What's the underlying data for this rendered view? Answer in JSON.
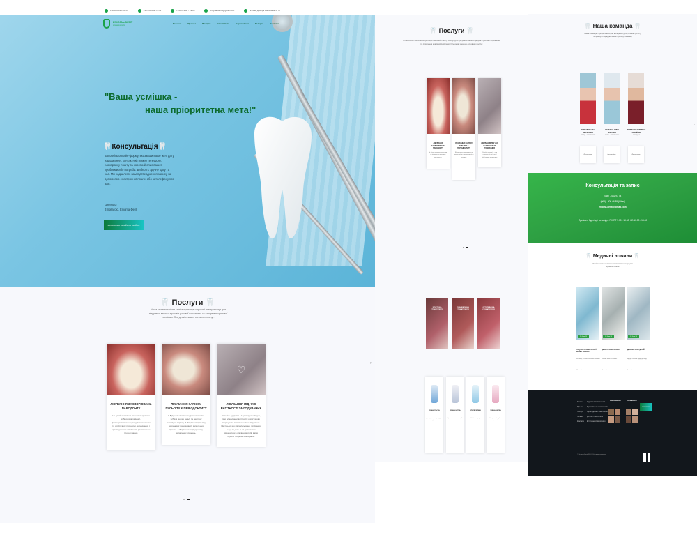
{
  "topbar": {
    "phone1": "+38 066-320-65-55",
    "phone2": "+38 068-652-74-74",
    "hours": "ПН-ПТ 9:00 - 19:00",
    "email": "enigma.dent0@gmail.com",
    "address": "м.Київ, Дмитра Шерепана 5, 72"
  },
  "logo": {
    "name": "ENIGMA-DENT",
    "tagline": "стоматологія"
  },
  "nav": [
    "Головна",
    "Про нас",
    "Послуги",
    "Спеціалісти",
    "Сертифікати",
    "Галерея",
    "Контакти"
  ],
  "hero": {
    "quote_line1": "\"Ваша усмішка -",
    "quote_line2": "наша пріоритетна мета!\"",
    "consult_title": "Консультація",
    "consult_text": "Заповніть онлайн-форму, вказавши ваше ім'я, дату народження, контактний номер телефону, електронну пошту та короткий опис вашої проблеми або потреби. Виберіть зручну дату та час. Ми надішлемо вам підтвердження запису за допомогою електронної пошти або зателефонуємо вам.",
    "thanks": "Дякуємо!",
    "regards": "З повагою, Enigma-Dent",
    "button": "ЗАПИСАТИСЬ ОНЛАЙН НА ПРИЙОМ"
  },
  "services": {
    "title": "Послуги",
    "desc": "Наша стоматологічна клініка пропонує широкий спектр послуг для підтримки вашого здоров'я ротової порожнини та створення красивої посмішки. Ось деякі з наших основних послуг:",
    "cards": [
      {
        "title": "ЛІКУВАННЯ ЗАХВОРЮВАНЬ ПАРОДОНТУ",
        "desc": "Це цілий комплекс пологових (чистка зубних відкладень), фізіотерапевтичних, медикаментозних та хірургічних процедур, шинування, і ортопедичного лікування, раціональне протезування."
      },
      {
        "title": "ЛІКУВАННЯ КАРІЄСУ ПУЛЬПІТУ & ПЕРІОДОНТИТУ",
        "desc": "● Відновлення пошкодження тканин зубів в межах емалі та дентину внаслідок карієсу. ● Лікування пульпіту (кореневої порожнини), запалення пульпи. ● Лікування періодонтиту запальних уражень."
      },
      {
        "title": "ЛІКУВАННЯ ПІД ЧАС ВАГІТНОСТІ ТА ГОДУВАННЯ",
        "desc": "Сімейне здоров'я - в цілому необхідно, при плануванні вагітності обов'язково звернутися стоматологічне лікування. Не тільки, що матимуть вони лікування, а ще та діло - і за допомогою своєчасного лікування зубів вами будете потрібно матеріали."
      }
    ]
  },
  "mid": {
    "title": "Послуги",
    "desc": "Стоматологічна клініка пропонує широкий спектр послуг для підтримки вашого здоров'я ротової порожнини та створення красивої посмішки. Ось деякі з наших основних послуг:",
    "cards": [
      {
        "title": "ЛІКУВАННЯ ЗАХВОРЮВАНЬ ПАРОДОНТУ",
        "desc": "Це цілий комплекс пологових та хірургічних процедур, шинування."
      },
      {
        "title": "ЛІКУВАННЯ КАРІЄСУ ПУЛЬПІТУ & ПЕРІОДОНТИТУ",
        "desc": "Відновлення пошкодження тканин зубів в межах емалі та дентину."
      },
      {
        "title": "ЛІКУВАННЯ ПІД ЧАС ВАГІТНОСТІ ТА ГОДУВАННЯ",
        "desc": "Сімейне здоров'я - при плануванні вагітності обов'язково звернутися."
      }
    ],
    "specs": [
      "ХІРУРГІЧНА СТОМАТОЛОГІЯ",
      "ТЕРАПЕВТИЧНА СТОМАТОЛОГІЯ",
      "ОРТОПЕДИЧНА СТОМАТОЛОГІЯ"
    ],
    "products": [
      {
        "title": "ЗУБНА ПАСТА",
        "desc": "Для щоденного догляду за зубами."
      },
      {
        "title": "ЗУБНА ЩІТКА",
        "desc": "Ефективне очищення зубів."
      },
      {
        "title": "ОПОЛІСКУВАЧ",
        "desc": "Свіжість подиху."
      },
      {
        "title": "ЗУБНА НИТКА",
        "desc": "Очищення міжзубних проміжків."
      }
    ]
  },
  "team": {
    "title": "Наша команда",
    "desc": "Наша команда - професіонали, які вкладають душу в кожну роботу та прагнуть подарувати вам здорову посмішку.",
    "doctors": [
      {
        "name": "СЕМЕНЮК АННА ВАСИЛІВНА",
        "role": "лікар - стоматолог",
        "btn": "Детальніше"
      },
      {
        "name": "БЕРЕЖНА ЮЛІЯ ОЛЕГІВНА",
        "role": "лікар - стоматолог",
        "btn": "Детальніше"
      },
      {
        "name": "ЯКИМЕНКО КАТЕРИНА СЕРГІЇВНА",
        "role": "ортодонт",
        "btn": "Детальніше"
      }
    ]
  },
  "contact": {
    "title": "Консультація та запис",
    "phone1": "(066) - 432 97 74",
    "phone2": "(068) - 209 46 89 (Viber)",
    "email": "enigma.dent0@gmail.com",
    "schedule": "Прийом в будні дні та вихідні: ПН-ПТ 9:00 - 19:00, СБ 10:00 - 15:00"
  },
  "news": {
    "title": "Медичні новини",
    "desc": "Читайте останні новини стоматології та медицини від нашої клініки.",
    "items": [
      {
        "date": "20 June 24",
        "title": "ПОРТАЛ СТОМАТОЛОГІЇ МАЙБУТНЬОГО",
        "text": "Інновації у стоматологічній практиці.",
        "more": "Читати >"
      },
      {
        "date": "18 June 24",
        "title": "ДЕНЬ СТОМАТОЛОГА",
        "text": "Вітаємо колег зі святом.",
        "more": "Читати >"
      },
      {
        "date": "12 June 24",
        "title": "ЗДОРОВІ ЗУБИ ДІТЕЙ",
        "text": "Поради батькам щодо догляду.",
        "more": "Читати >"
      }
    ]
  },
  "footer": {
    "col1": [
      "Головна",
      "Про нас",
      "Послуги",
      "Галерея",
      "Контакти"
    ],
    "col2": [
      "Хірургічна стоматологія",
      "Терапевтична стоматологія",
      "Ортопедична стоматологія",
      "Дитяча стоматологія",
      "Естетична стоматологія"
    ],
    "head_instagram": "INSTAGRAM",
    "head_facebook": "FACEBOOK",
    "button": "ЗАПИСАТИСЯ",
    "copyright": "© Enigma-Dent 2024 | Усі права захищені"
  },
  "colors": {
    "brand_green": "#1aa34a",
    "hero_blue": "#7ac5e3",
    "footer_dark": "#12171c"
  }
}
